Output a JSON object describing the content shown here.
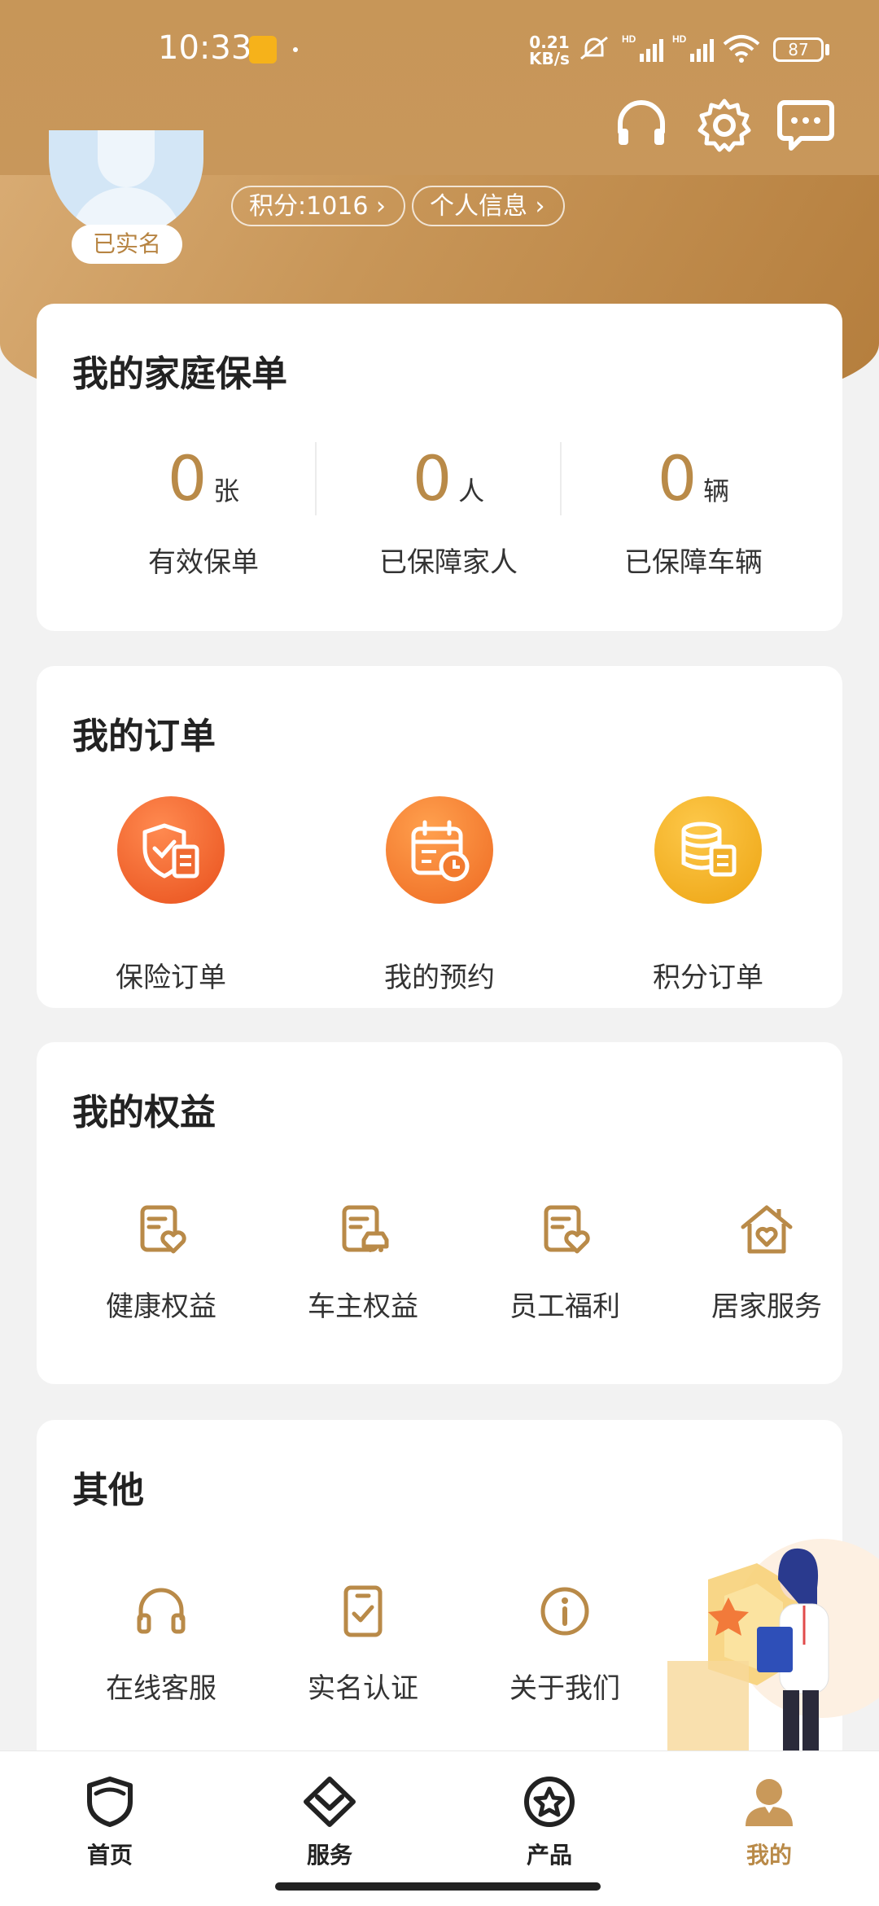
{
  "status_bar": {
    "time": "10:33",
    "net_speed_value": "0.21",
    "net_speed_unit": "KB/s",
    "battery": "87"
  },
  "profile": {
    "verified_badge": "已实名",
    "points_label": "积分:1016 ›",
    "personal_info_label": "个人信息 ›"
  },
  "family_policy": {
    "title": "我的家庭保单",
    "stats": [
      {
        "value": "0",
        "unit": "张",
        "label": "有效保单"
      },
      {
        "value": "0",
        "unit": "人",
        "label": "已保障家人"
      },
      {
        "value": "0",
        "unit": "辆",
        "label": "已保障车辆"
      }
    ]
  },
  "orders": {
    "title": "我的订单",
    "items": [
      {
        "label": "保险订单",
        "icon": "shield-doc-icon"
      },
      {
        "label": "我的预约",
        "icon": "calendar-clock-icon"
      },
      {
        "label": "积分订单",
        "icon": "coins-doc-icon"
      }
    ]
  },
  "benefits": {
    "title": "我的权益",
    "items": [
      {
        "label": "健康权益",
        "icon": "doc-heart-icon"
      },
      {
        "label": "车主权益",
        "icon": "doc-car-icon"
      },
      {
        "label": "员工福利",
        "icon": "doc-heart-icon"
      },
      {
        "label": "居家服务",
        "icon": "house-heart-icon"
      }
    ]
  },
  "others": {
    "title": "其他",
    "items": [
      {
        "label": "在线客服",
        "icon": "headset-icon"
      },
      {
        "label": "实名认证",
        "icon": "id-check-icon"
      },
      {
        "label": "关于我们",
        "icon": "info-icon"
      }
    ]
  },
  "bottom_nav": {
    "items": [
      {
        "label": "首页",
        "icon": "home-shield-icon"
      },
      {
        "label": "服务",
        "icon": "service-diamond-icon"
      },
      {
        "label": "产品",
        "icon": "product-star-icon"
      },
      {
        "label": "我的",
        "icon": "profile-person-icon",
        "active": true
      }
    ]
  },
  "colors": {
    "brand_gold": "#b98a48",
    "header_gradient_start": "#dcb079",
    "header_gradient_end": "#b47d3c"
  }
}
